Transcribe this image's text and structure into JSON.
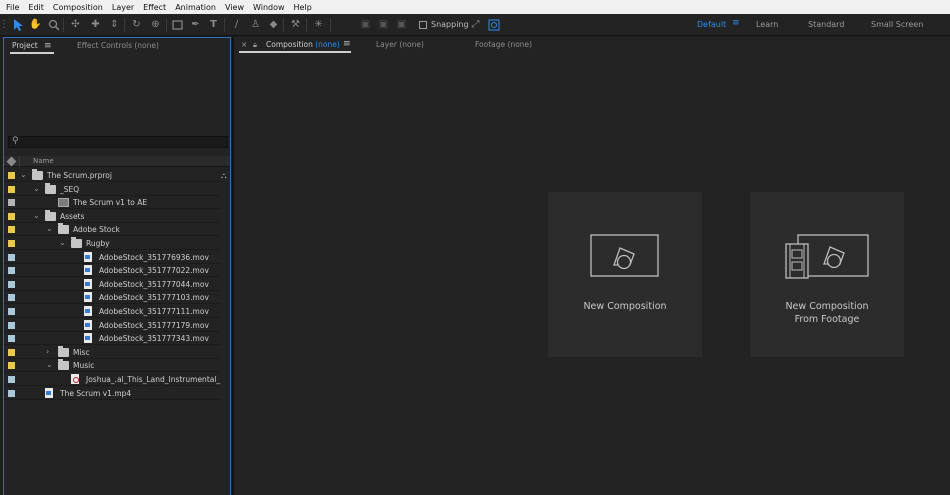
{
  "menu": [
    "File",
    "Edit",
    "Composition",
    "Layer",
    "Effect",
    "Animation",
    "View",
    "Window",
    "Help"
  ],
  "toolbar": {
    "snapping_label": "Snapping",
    "workspaces": [
      "Default",
      "Learn",
      "Standard",
      "Small Screen"
    ],
    "active_workspace": "Default"
  },
  "project_panel": {
    "tabs": [
      "Project",
      "Effect Controls (none)"
    ],
    "search_placeholder": "",
    "column_name": "Name",
    "items": [
      {
        "name": "The Scrum.prproj",
        "type": "folder",
        "label": "#e8c94a",
        "twirl": "open"
      },
      {
        "name": "_SEQ",
        "type": "folder",
        "label": "#e8c94a",
        "twirl": "open"
      },
      {
        "name": "The Scrum v1 to AE",
        "type": "comp",
        "label": "#b4b4b4",
        "twirl": ""
      },
      {
        "name": "Assets",
        "type": "folder",
        "label": "#e8c94a",
        "twirl": "open"
      },
      {
        "name": "Adobe Stock",
        "type": "folder",
        "label": "#e8c94a",
        "twirl": "open"
      },
      {
        "name": "Rugby",
        "type": "folder",
        "label": "#e8c94a",
        "twirl": "open"
      },
      {
        "name": "AdobeStock_351776936.mov",
        "type": "footage",
        "label": "#a9c9d8",
        "twirl": ""
      },
      {
        "name": "AdobeStock_351777022.mov",
        "type": "footage",
        "label": "#a9c9d8",
        "twirl": ""
      },
      {
        "name": "AdobeStock_351777044.mov",
        "type": "footage",
        "label": "#a9c9d8",
        "twirl": ""
      },
      {
        "name": "AdobeStock_351777103.mov",
        "type": "footage",
        "label": "#a9c9d8",
        "twirl": ""
      },
      {
        "name": "AdobeStock_351777111.mov",
        "type": "footage",
        "label": "#a9c9d8",
        "twirl": ""
      },
      {
        "name": "AdobeStock_351777179.mov",
        "type": "footage",
        "label": "#a9c9d8",
        "twirl": ""
      },
      {
        "name": "AdobeStock_351777343.mov",
        "type": "footage",
        "label": "#a9c9d8",
        "twirl": ""
      },
      {
        "name": "Misc",
        "type": "folder",
        "label": "#e8c94a",
        "twirl": "closed"
      },
      {
        "name": "Music",
        "type": "folder",
        "label": "#e8c94a",
        "twirl": "open"
      },
      {
        "name": "Joshua_.al_This_Land_Instrumental_",
        "type": "audio",
        "label": "#a9c9d8",
        "twirl": ""
      },
      {
        "name": "The Scrum v1.mp4",
        "type": "footage",
        "label": "#a9c9d8",
        "twirl": ""
      }
    ]
  },
  "comp_panel": {
    "tabs": [
      {
        "label": "Composition",
        "suffix": "(none)"
      },
      {
        "label": "Layer",
        "suffix": "(none)"
      },
      {
        "label": "Footage",
        "suffix": "(none)"
      }
    ],
    "cards": [
      {
        "line1": "New Composition",
        "line2": ""
      },
      {
        "line1": "New Composition",
        "line2": "From Footage"
      }
    ]
  },
  "colors": {
    "accent": "#2d8ceb",
    "folder_label": "#e8c94a",
    "footage_label": "#a9c9d8"
  }
}
